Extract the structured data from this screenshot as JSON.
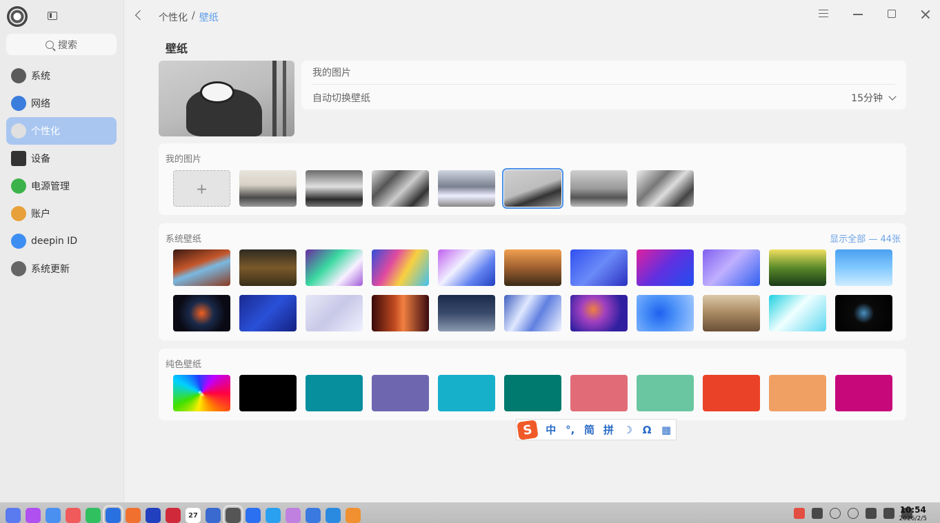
{
  "sidebar": {
    "search_placeholder": "搜索",
    "items": [
      {
        "label": "系统",
        "icon": "system-icon",
        "color": "#5b5b5b"
      },
      {
        "label": "网络",
        "icon": "network-icon",
        "color": "#3b7ddd"
      },
      {
        "label": "个性化",
        "icon": "personalization-icon",
        "color": "#e0e0e0"
      },
      {
        "label": "设备",
        "icon": "device-icon",
        "color": "#333333"
      },
      {
        "label": "电源管理",
        "icon": "power-icon",
        "color": "#3bb34a"
      },
      {
        "label": "账户",
        "icon": "account-icon",
        "color": "#e8a13a"
      },
      {
        "label": "deepin ID",
        "icon": "cloud-icon",
        "color": "#3d8ef2"
      },
      {
        "label": "系统更新",
        "icon": "update-icon",
        "color": "#666666"
      }
    ]
  },
  "breadcrumb": {
    "parent": "个性化",
    "separator": "/",
    "current": "壁纸"
  },
  "page_title": "壁纸",
  "options": {
    "picture_source": "我的图片",
    "auto_switch_label": "自动切换壁纸",
    "auto_switch_value": "15分钟"
  },
  "my_pictures": {
    "label": "我的图片",
    "add_symbol": "+",
    "thumbs": [
      "linear-gradient(180deg,#e8e4dc 0%,#d8d2c6 40%,#4a4a4a 75%,#9a9a9a 100%)",
      "linear-gradient(180deg,#6a6a6a 0%,#e0e0e0 45%,#2a2a2a 80%,#777 100%)",
      "linear-gradient(135deg,#ddd 0%,#555 30%,#ccc 55%,#333 80%,#bbb 100%)",
      "linear-gradient(180deg,#cfd4e0 0%,#7a8090 45%,#eef 70%,#888 100%)",
      "linear-gradient(160deg,#cfcfcf 0%,#bdbdbd 50%,#333 70%,#999 100%)",
      "linear-gradient(180deg,#cfcfcf 0%,#9a9a9a 50%,#555 75%,#bbb 100%)",
      "linear-gradient(135deg,#eee 0%,#777 35%,#ddd 55%,#444 80%,#aaa 100%)"
    ]
  },
  "system_wallpapers": {
    "label": "系统壁纸",
    "show_all": "显示全部 — 44张",
    "thumbs": [
      "linear-gradient(160deg,#3b1a12 0%,#c4562a 40%,#7ab8e0 55%,#8a3a20 100%)",
      "linear-gradient(180deg,#2e2a20 0%,#7a5a2a 50%,#3a2e18 100%)",
      "linear-gradient(135deg,#6a2aa0 0%,#3ad8a0 40%,#f8f0ff 70%,#a05ad8 100%)",
      "linear-gradient(120deg,#3050d8 0%,#e04aa0 35%,#f8d040 60%,#40c0f0 100%)",
      "linear-gradient(135deg,#c060f0 0%,#f0f0ff 40%,#6080f0 70%,#2040c0 100%)",
      "linear-gradient(180deg,#f0a050 0%,#a06030 50%,#3a2a18 100%)",
      "linear-gradient(135deg,#3050f0 0%,#6a8af8 50%,#2a30c0 100%)",
      "linear-gradient(135deg,#e020a0 0%,#6030e0 50%,#2050f0 100%)",
      "linear-gradient(135deg,#8060f0 0%,#c0b0ff 45%,#3060f0 100%)",
      "linear-gradient(180deg,#f0e060 0%,#5a8a2a 50%,#1a3a18 100%)",
      "linear-gradient(180deg,#4aa0f0 0%,#80c8ff 50%,#d0ecff 100%)",
      "radial-gradient(circle at 50% 50%,#f06020 0%,#1a2a4a 35%,#0a0a14 70%)",
      "linear-gradient(135deg,#1a2a90 0%,#2a50d8 50%,#142080 100%)",
      "linear-gradient(135deg,#e8e8f8 0%,#c8c8e8 50%,#f0f0ff 100%)",
      "linear-gradient(90deg,#3a0a0a 0%,#c04a20 40%,#f08040 55%,#3a0a10 100%)",
      "linear-gradient(180deg,#1a2a4a 0%,#3a4a6a 50%,#8a9ab0 100%)",
      "linear-gradient(120deg,#4060c0 0%,#e0e8ff 35%,#6080e0 60%,#f0f4ff 100%)",
      "radial-gradient(circle at 40% 40%,#f08040 0%,#a040c0 30%,#3020a0 70%)",
      "radial-gradient(circle at 40% 50%,#2060f0 0%,#4a90f8 40%,#a0c8ff 100%)",
      "linear-gradient(180deg,#dcc8a8 0%,#a88860 50%,#6a5038 100%)",
      "linear-gradient(135deg,#20d0e0 0%,#f0ffff 45%,#60d8f0 100%)",
      "radial-gradient(circle at 50% 50%,#4a90c0 0%,#0a0a0a 30%,#000 100%)"
    ]
  },
  "solid_colors": {
    "label": "纯色壁纸",
    "colors": [
      "#000000",
      "#088f9e",
      "#6e67b0",
      "#16b0cb",
      "#007a6e",
      "#e16c78",
      "#69c6a1",
      "#ea4228",
      "#f1a064",
      "#c6087a"
    ]
  },
  "ime": {
    "logo": "S",
    "items": [
      "中",
      "°,",
      "简",
      "拼",
      "☽",
      "Ω",
      "▦"
    ]
  },
  "taskbar": {
    "time": "10:54",
    "date": "2026/2/5",
    "calendar_day": "27"
  }
}
